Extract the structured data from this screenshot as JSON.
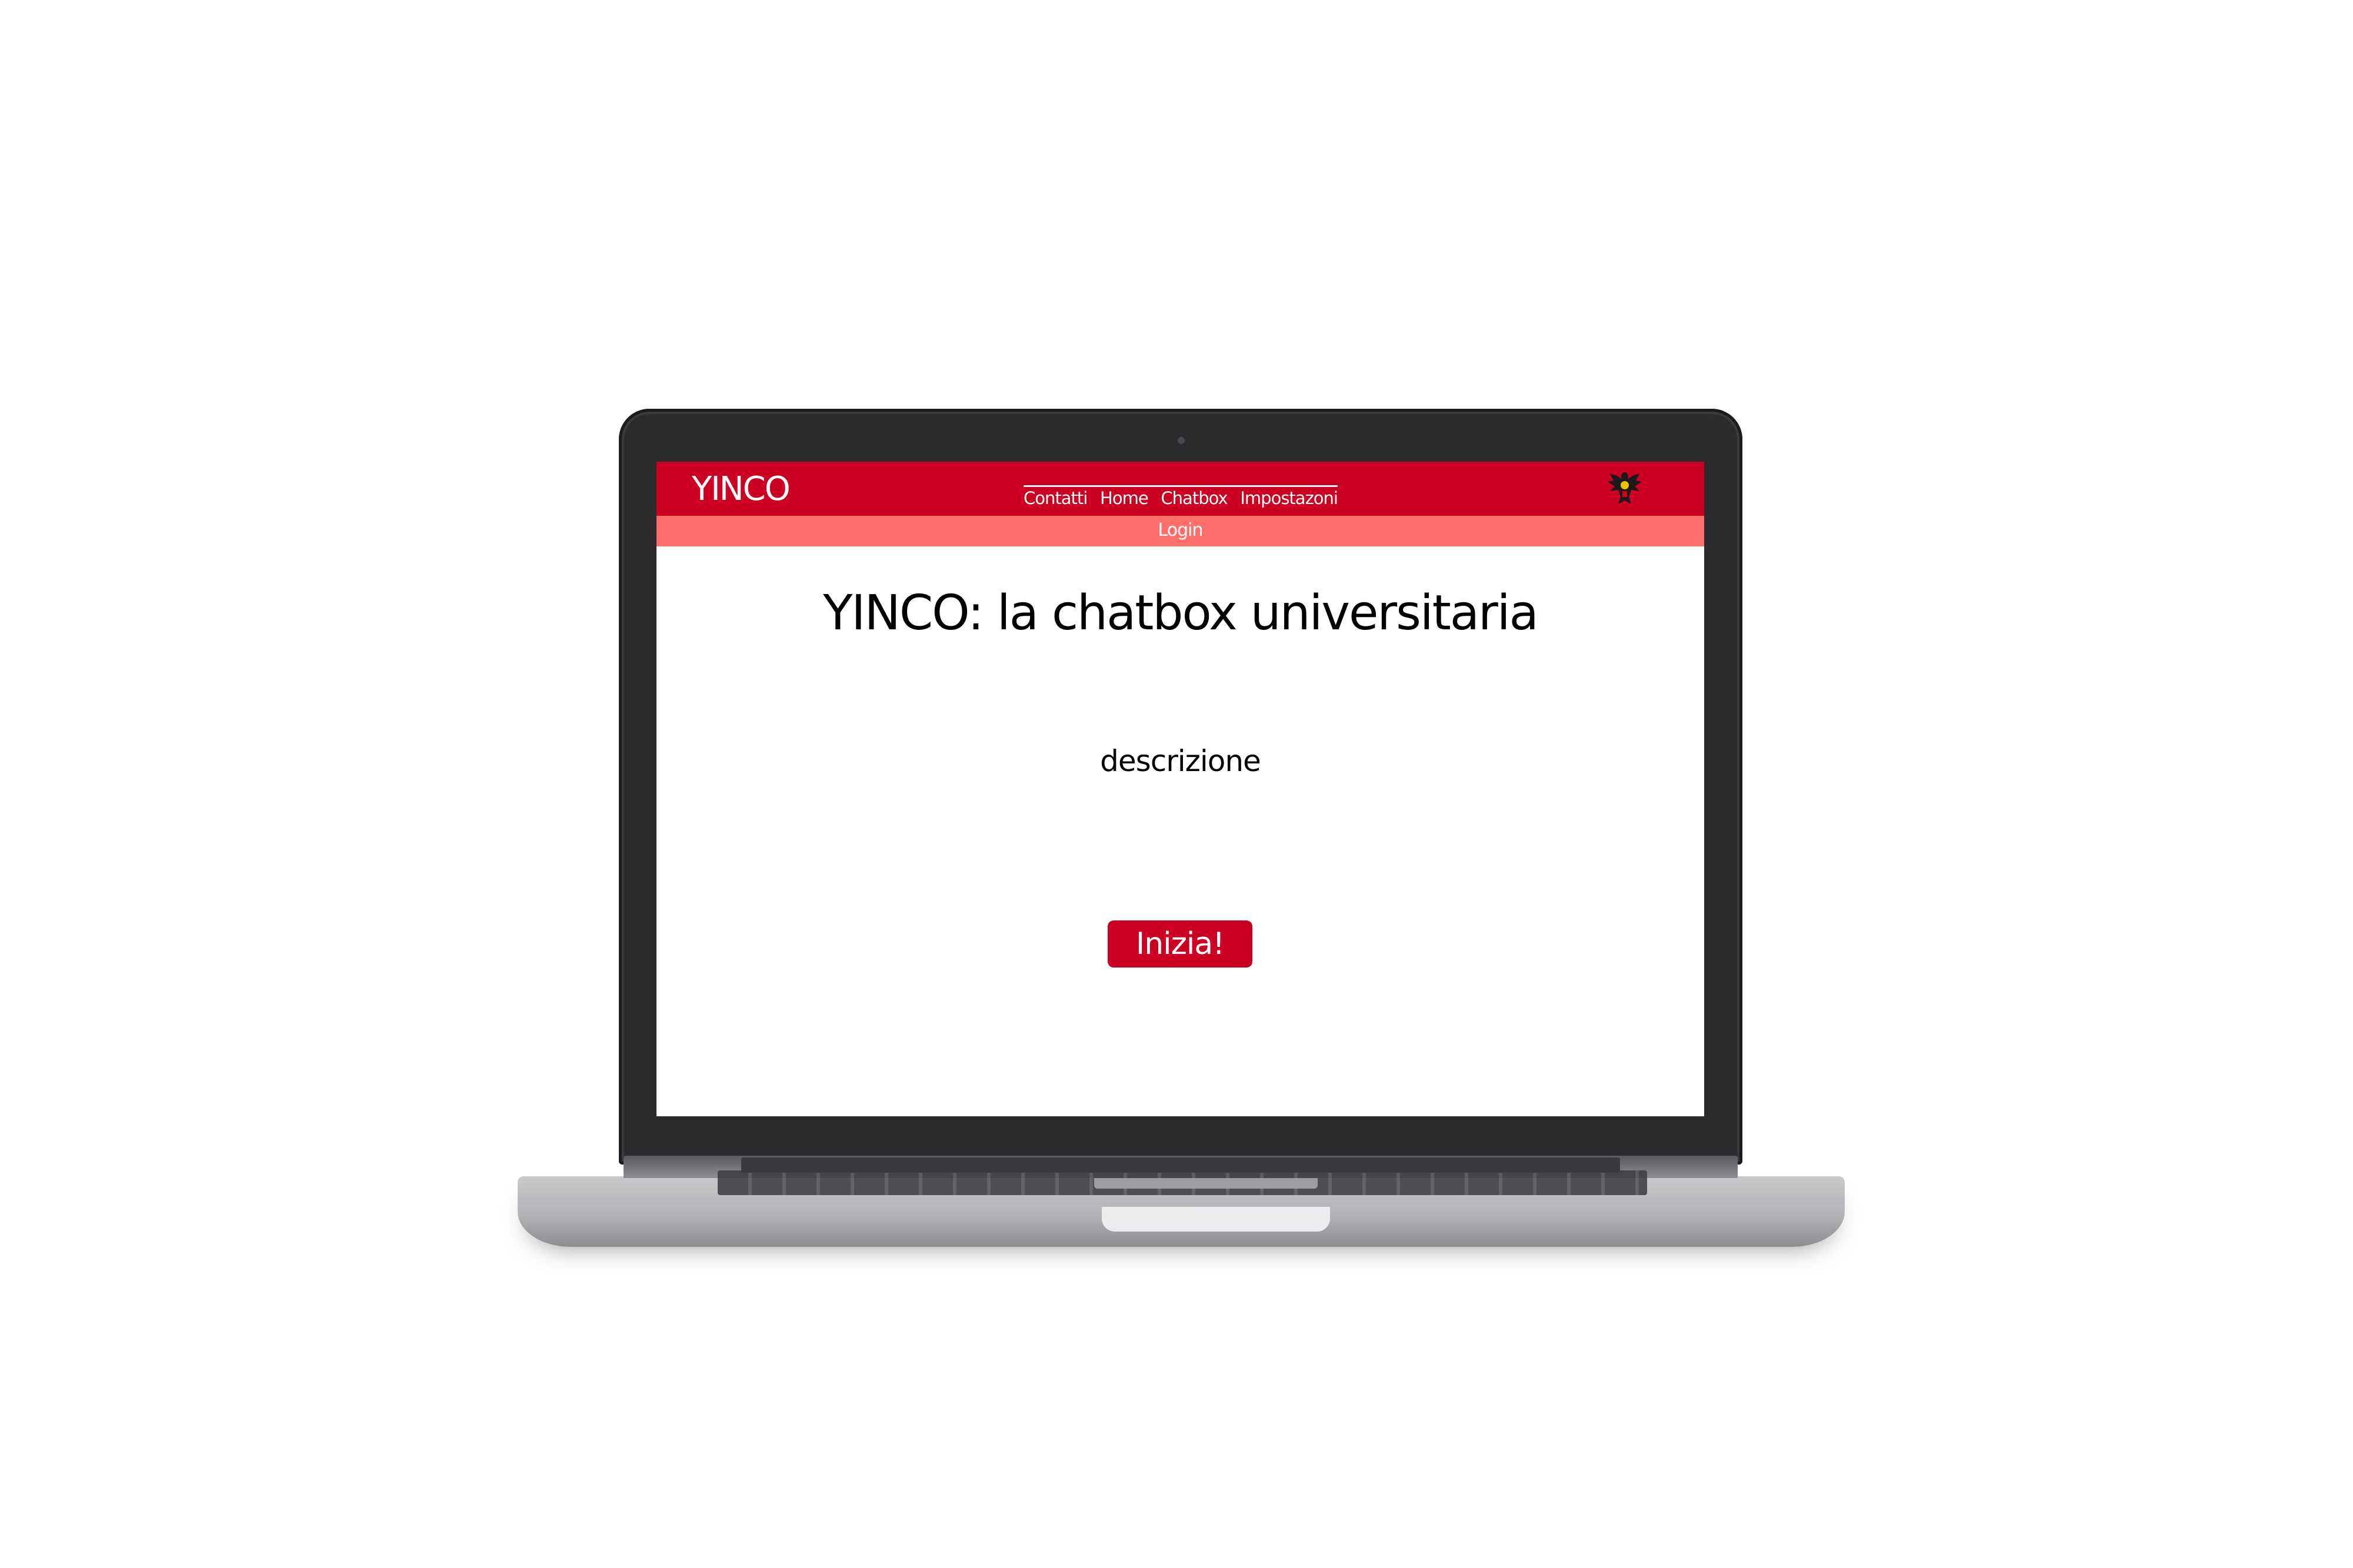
{
  "header": {
    "logo": "YINCO",
    "nav": [
      "Contatti",
      "Home",
      "Chatbox",
      "Impostazoni"
    ],
    "login": "Login",
    "emblem_icon": "eagle-emblem-icon"
  },
  "main": {
    "title": "YINCO: la chatbox universitaria",
    "description": "descrizione",
    "cta": "Inizia!"
  },
  "colors": {
    "brand_red": "#cc0022",
    "secondary_bar": "#ff6e6b",
    "laptop_bezel": "#2b2b2d"
  }
}
